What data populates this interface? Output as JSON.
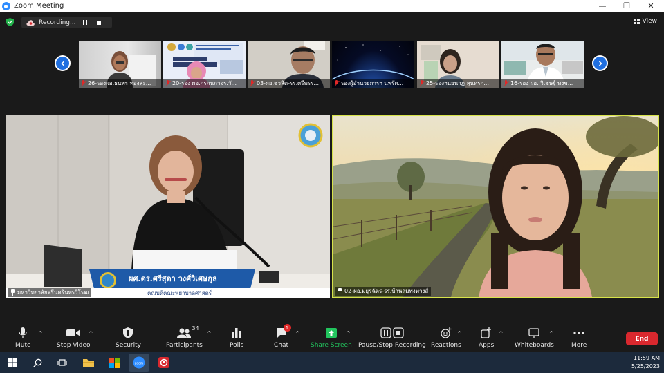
{
  "window": {
    "title": "Zoom Meeting"
  },
  "topbar": {
    "recording_label": "Recording...",
    "view_label": "View"
  },
  "thumbnails": [
    {
      "name": "26-รองผอ.ธนพร ทองสะ..."
    },
    {
      "name": "20-รอง ผอ.กรกนกาจร.วั..."
    },
    {
      "name": "03-ผอ.ชวลิต-รร.ศรีพรร..."
    },
    {
      "name": "รองผู้อำนวยการฯ นพรัต..."
    },
    {
      "name": "25-รองฯนยนาฏ สุนทรก..."
    },
    {
      "name": "16-รอง ผอ. วิเชษฐ์ ทงช..."
    }
  ],
  "video_left": {
    "name": "มหาวิทยาลัยศรีนครินทรวิโรฒ",
    "caption_name": "ผศ.ดร.ศรีสุดา วงศ์วิเศษกุล",
    "caption_role": "คณบดีคณะพยาบาลศาสตร์"
  },
  "video_right": {
    "name": "02-ผอ.มยุรฉัตร-รร.บ้านสมพงทวงส์"
  },
  "toolbar": {
    "mute": "Mute",
    "stop_video": "Stop Video",
    "security": "Security",
    "participants": "Participants",
    "participants_count": "34",
    "polls": "Polls",
    "chat": "Chat",
    "chat_badge": "1",
    "share_screen": "Share Screen",
    "pause_stop_recording": "Pause/Stop Recording",
    "reactions": "Reactions",
    "apps": "Apps",
    "whiteboards": "Whiteboards",
    "more": "More",
    "end": "End"
  },
  "taskbar": {
    "time": "11:59 AM",
    "date": "5/25/2023"
  },
  "colors": {
    "zoom_blue": "#2d8cff",
    "share_green": "#22c55e",
    "end_red": "#d9282e",
    "active_speaker": "#d7e34a",
    "taskbar": "#1c2a3c"
  }
}
